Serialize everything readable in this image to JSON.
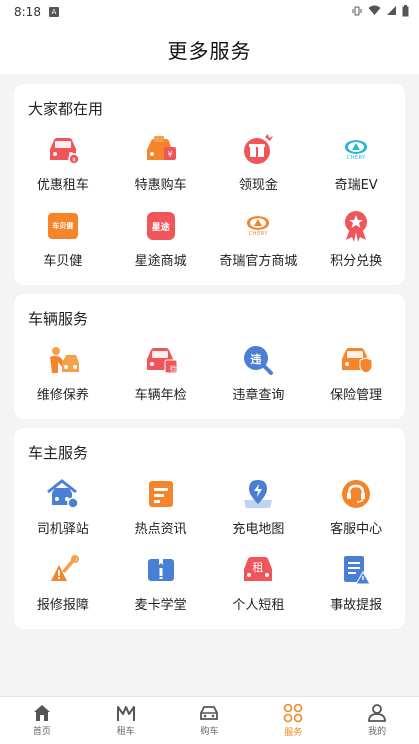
{
  "status": {
    "time": "8:18",
    "notif_label": "A"
  },
  "header": {
    "title": "更多服务"
  },
  "sections": [
    {
      "title": "大家都在用",
      "items": [
        {
          "label": "优惠租车",
          "icon": "discount-rental-car-icon"
        },
        {
          "label": "特惠购车",
          "icon": "special-offer-purchase-icon"
        },
        {
          "label": "领现金",
          "icon": "cash-gift-icon"
        },
        {
          "label": "奇瑞EV",
          "icon": "chery-ev-logo-icon",
          "logo_text": "CHERY"
        },
        {
          "label": "车贝健",
          "icon": "chebeijian-logo-icon",
          "logo_text": "车贝健"
        },
        {
          "label": "星途商城",
          "icon": "xingtu-mall-logo-icon",
          "logo_text": "星途"
        },
        {
          "label": "奇瑞官方商城",
          "icon": "chery-official-mall-icon",
          "logo_text": "CHERY"
        },
        {
          "label": "积分兑换",
          "icon": "points-exchange-icon"
        }
      ]
    },
    {
      "title": "车辆服务",
      "items": [
        {
          "label": "维修保养",
          "icon": "maintenance-icon"
        },
        {
          "label": "车辆年检",
          "icon": "annual-inspection-icon",
          "badge": "检"
        },
        {
          "label": "违章查询",
          "icon": "violation-query-icon",
          "badge": "违"
        },
        {
          "label": "保险管理",
          "icon": "insurance-icon"
        }
      ]
    },
    {
      "title": "车主服务",
      "items": [
        {
          "label": "司机驿站",
          "icon": "driver-station-icon"
        },
        {
          "label": "热点资讯",
          "icon": "hot-news-icon"
        },
        {
          "label": "充电地图",
          "icon": "charging-map-icon"
        },
        {
          "label": "客服中心",
          "icon": "customer-service-icon"
        },
        {
          "label": "报修报障",
          "icon": "repair-report-icon"
        },
        {
          "label": "麦卡学堂",
          "icon": "maika-school-icon"
        },
        {
          "label": "个人短租",
          "icon": "personal-short-rental-icon",
          "badge": "租"
        },
        {
          "label": "事故提报",
          "icon": "accident-report-icon"
        }
      ]
    }
  ],
  "tabs": [
    {
      "label": "首页",
      "icon": "home-icon",
      "active": false
    },
    {
      "label": "租车",
      "icon": "rental-icon",
      "active": false
    },
    {
      "label": "购车",
      "icon": "car-icon",
      "active": false
    },
    {
      "label": "服务",
      "icon": "services-icon",
      "active": true
    },
    {
      "label": "我的",
      "icon": "profile-icon",
      "active": false
    }
  ],
  "colors": {
    "red": "#f0555a",
    "orange": "#f5842a",
    "blue": "#4a7fd6",
    "teal": "#2bb5d8",
    "tab_active": "#f08a24"
  }
}
